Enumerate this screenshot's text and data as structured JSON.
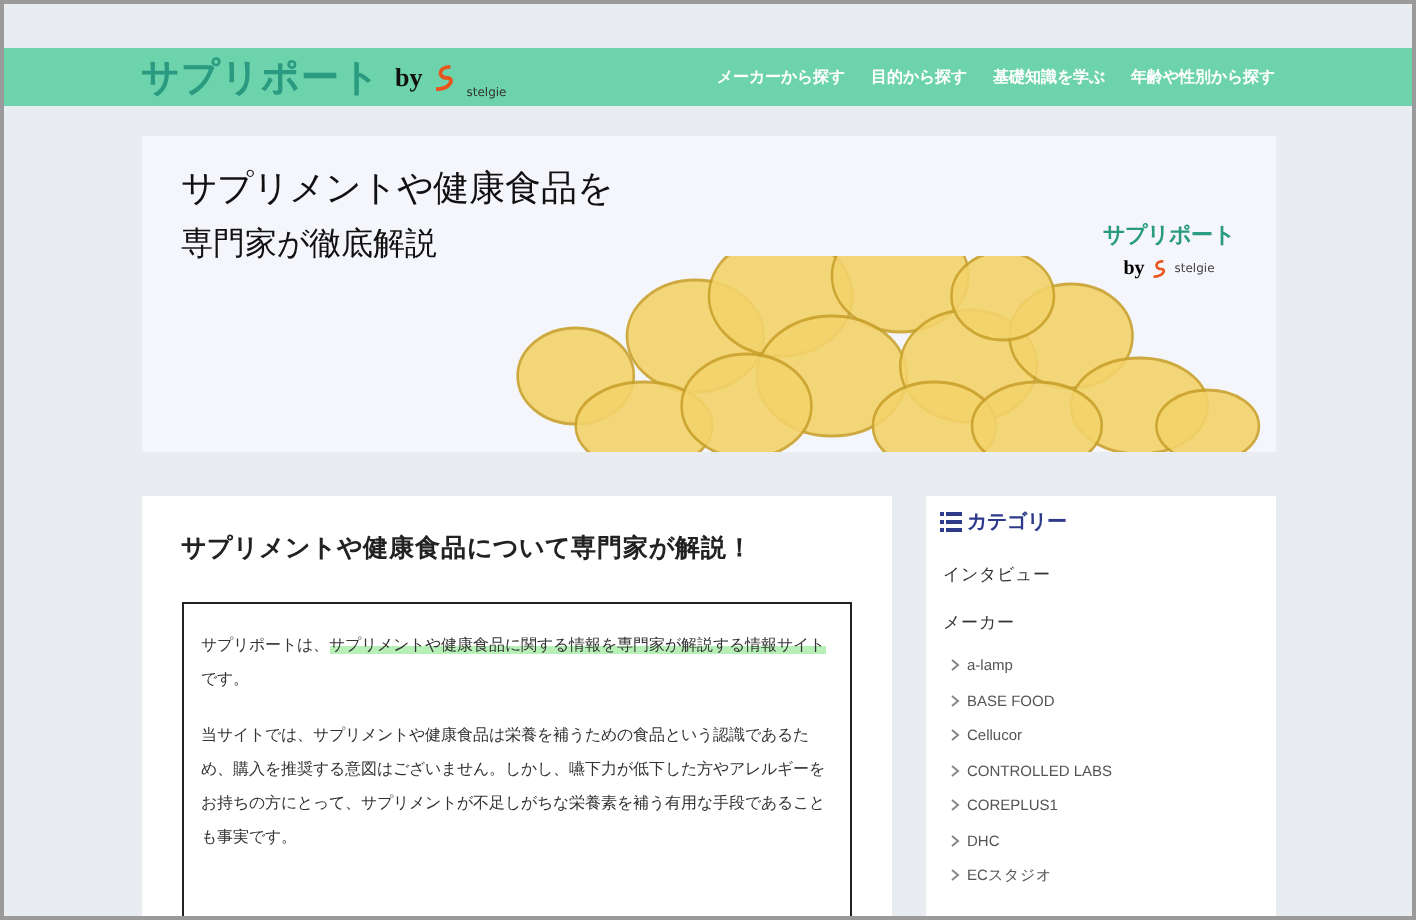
{
  "header": {
    "logo": {
      "name": "サプリポート",
      "by": "by",
      "brand": "stelgie"
    },
    "nav": [
      {
        "label": "メーカーから探す"
      },
      {
        "label": "目的から探す"
      },
      {
        "label": "基礎知識を学ぶ"
      },
      {
        "label": "年齢や性別から探す"
      }
    ]
  },
  "hero": {
    "headline": [
      "サプリメントや健康食品を",
      "専門家が徹底解説"
    ],
    "logo": {
      "name": "サプリポート",
      "by": "by",
      "brand": "stelgie"
    }
  },
  "main": {
    "title": "サプリメントや健康食品について専門家が解説！",
    "paragraphs": [
      [
        {
          "text": "サプリポートは、",
          "highlighted": false
        },
        {
          "text": "サプリメントや健康食品に関する情報を専門家が解説する情報サイト",
          "highlighted": true
        },
        {
          "text": "です。",
          "highlighted": false
        }
      ],
      [
        {
          "text": "当サイトでは、サプリメントや健康食品は栄養を補うための食品という認識であるため、購入を推奨する意図はございません。しかし、嚥下力が低下した方やアレルギーをお持ちの方にとって、サプリメントが不足しがちな栄養素を補う有用な手段であることも事実です。",
          "highlighted": false
        }
      ]
    ]
  },
  "sidebar": {
    "title": "カテゴリー",
    "items": [
      {
        "label": "インタビュー"
      },
      {
        "label": "メーカー",
        "children": [
          {
            "label": "a-lamp"
          },
          {
            "label": "BASE FOOD"
          },
          {
            "label": "Cellucor"
          },
          {
            "label": "CONTROLLED LABS"
          },
          {
            "label": "COREPLUS1"
          },
          {
            "label": "DHC"
          },
          {
            "label": "ECスタジオ"
          }
        ]
      }
    ]
  }
}
